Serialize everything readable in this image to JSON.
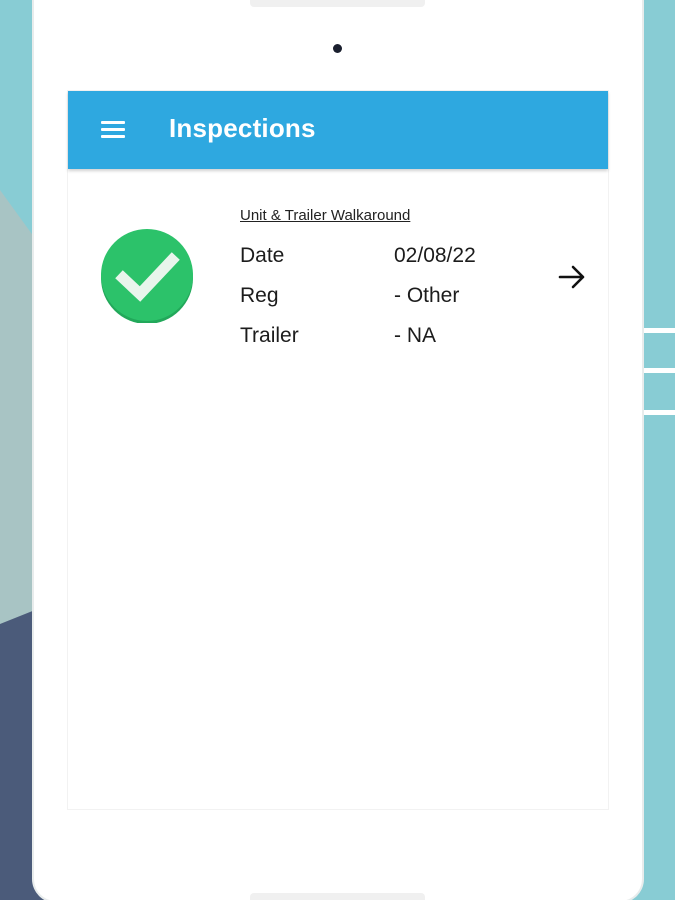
{
  "app_bar": {
    "title": "Inspections",
    "menu_icon": "menu-icon",
    "color": "#2ea8e0"
  },
  "inspections": [
    {
      "title": "Unit & Trailer Walkaround",
      "status_icon": "check-circle-icon",
      "status_color": "#2cc26a",
      "fields": [
        {
          "label": "Date",
          "value": "02/08/22"
        },
        {
          "label": "Reg",
          "value": "- Other"
        },
        {
          "label": "Trailer",
          "value": "- NA"
        }
      ],
      "open_icon": "arrow-right-icon"
    }
  ]
}
